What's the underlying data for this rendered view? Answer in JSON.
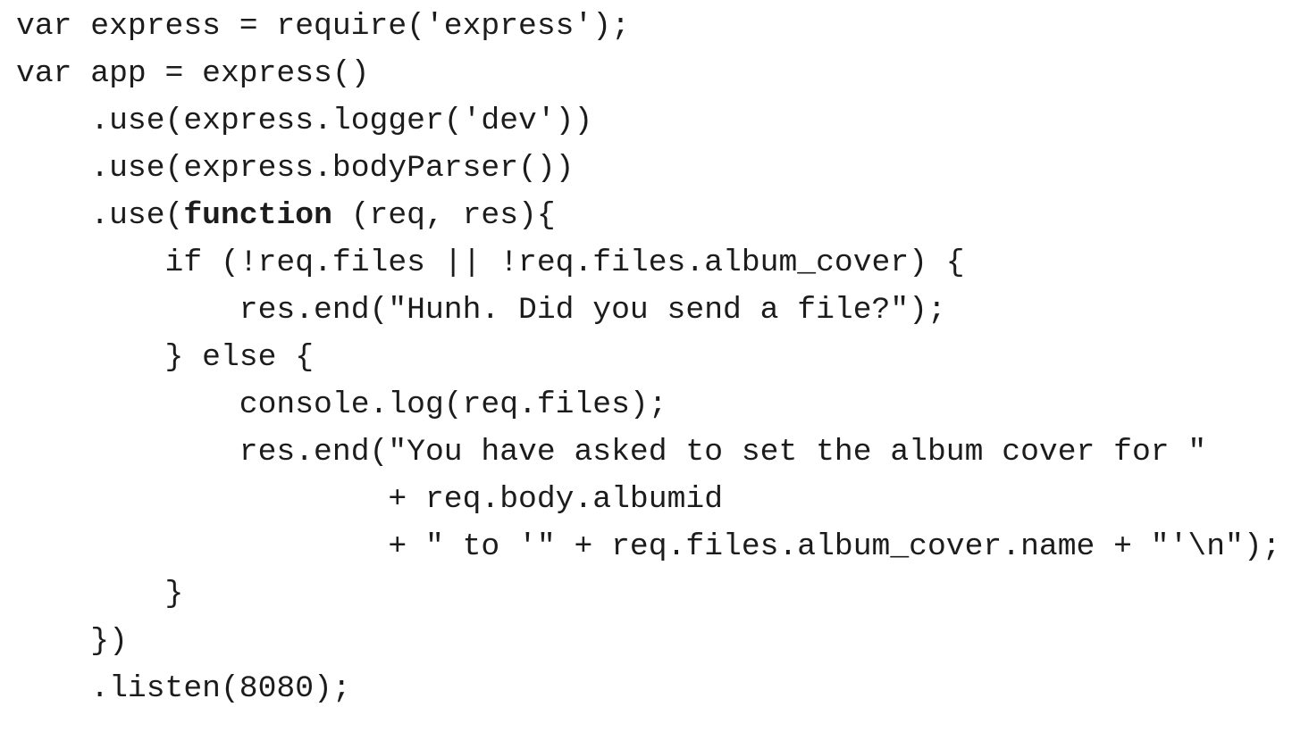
{
  "code": {
    "lines": [
      {
        "indent": "",
        "text": "var express = require('express');"
      },
      {
        "indent": "",
        "text": "var app = express()"
      },
      {
        "indent": "    ",
        "text": ".use(express.logger('dev'))"
      },
      {
        "indent": "    ",
        "text": ".use(express.bodyParser())"
      },
      {
        "indent": "    ",
        "pre": ".use(",
        "keyword": "function",
        "post": " (req, res){"
      },
      {
        "indent": "        ",
        "text": "if (!req.files || !req.files.album_cover) {"
      },
      {
        "indent": "            ",
        "text": "res.end(\"Hunh. Did you send a file?\");"
      },
      {
        "indent": "        ",
        "text": "} else {"
      },
      {
        "indent": "            ",
        "text": "console.log(req.files);"
      },
      {
        "indent": "            ",
        "text": "res.end(\"You have asked to set the album cover for \""
      },
      {
        "indent": "                    ",
        "text": "+ req.body.albumid"
      },
      {
        "indent": "                    ",
        "text": "+ \" to '\" + req.files.album_cover.name + \"'\\n\");"
      },
      {
        "indent": "        ",
        "text": "}"
      },
      {
        "indent": "    ",
        "text": "})"
      },
      {
        "indent": "    ",
        "text": ".listen(8080);"
      }
    ]
  }
}
